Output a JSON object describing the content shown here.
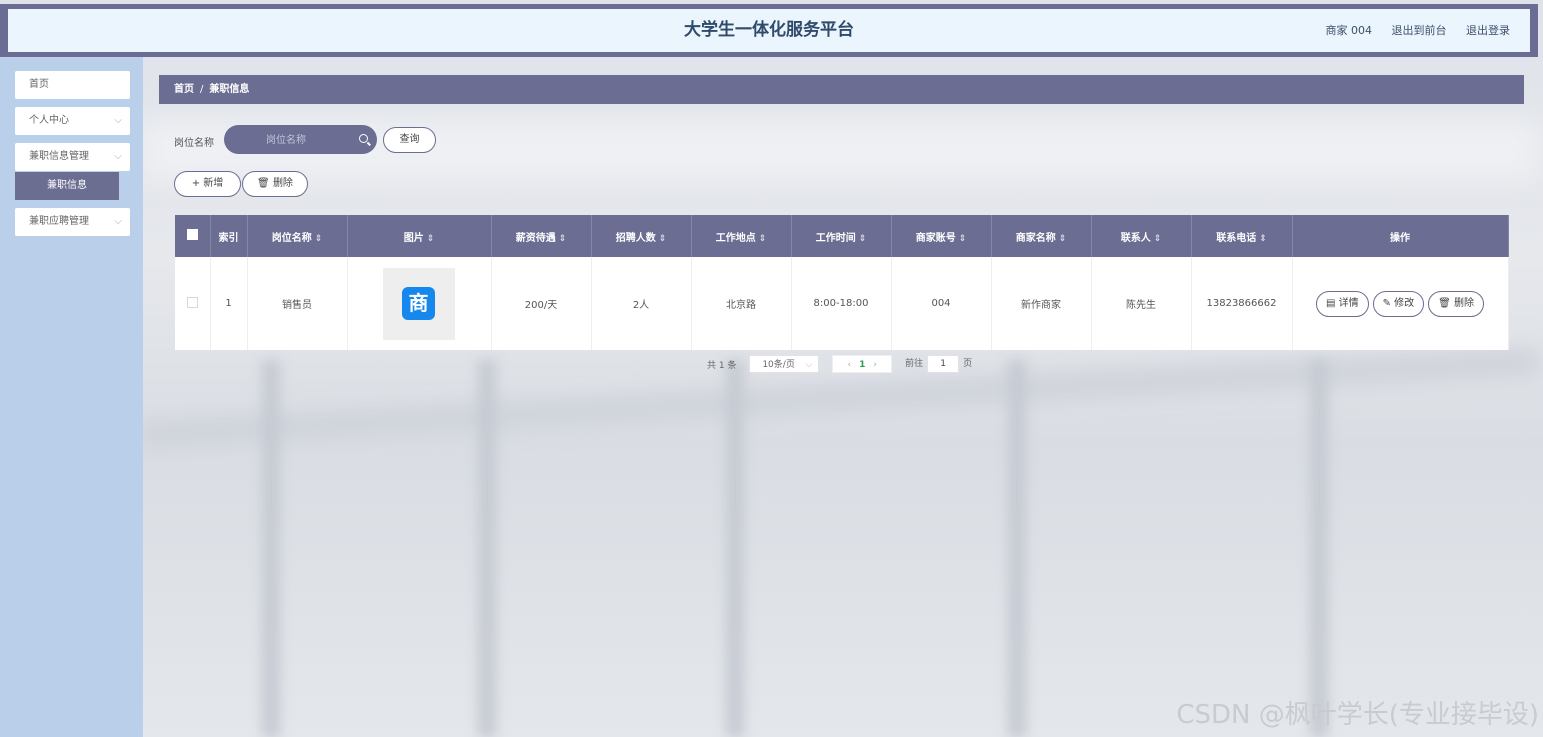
{
  "header": {
    "title": "大学生一体化服务平台",
    "user": "商家 004",
    "link_front": "退出到前台",
    "link_logout": "退出登录"
  },
  "sidebar": {
    "items": [
      {
        "label": "首页"
      },
      {
        "label": "个人中心"
      },
      {
        "label": "兼职信息管理"
      },
      {
        "label": "兼职信息"
      },
      {
        "label": "兼职应聘管理"
      }
    ]
  },
  "breadcrumb": {
    "home": "首页",
    "current": "兼职信息",
    "separator": "/"
  },
  "search": {
    "label": "岗位名称",
    "placeholder": "岗位名称",
    "query_button": "查询"
  },
  "toolbar": {
    "add_label": "+ 新增",
    "delete_label": "删除"
  },
  "table": {
    "columns": [
      "索引",
      "岗位名称",
      "图片",
      "薪资待遇",
      "招聘人数",
      "工作地点",
      "工作时间",
      "商家账号",
      "商家名称",
      "联系人",
      "联系电话",
      "操作"
    ],
    "rows": [
      {
        "index": "1",
        "position": "销售员",
        "image_char": "商",
        "salary": "200/天",
        "headcount": "2人",
        "location": "北京路",
        "hours": "8:00-18:00",
        "merchant_account": "004",
        "merchant_name": "新作商家",
        "contact": "陈先生",
        "phone": "13823866662",
        "actions": {
          "detail": "详情",
          "edit": "修改",
          "delete": "删除"
        }
      }
    ]
  },
  "pagination": {
    "total": "共 1 条",
    "page_size": "10条/页",
    "current_page": "1",
    "goto_label": "前往",
    "goto_value": "1",
    "page_suffix": "页"
  },
  "watermark": "CSDN @枫叶学长(专业接毕设)",
  "colors": {
    "accent": "#6b6d92",
    "sidebar": "#b9cfea",
    "header_bg": "#eaf5fd"
  }
}
